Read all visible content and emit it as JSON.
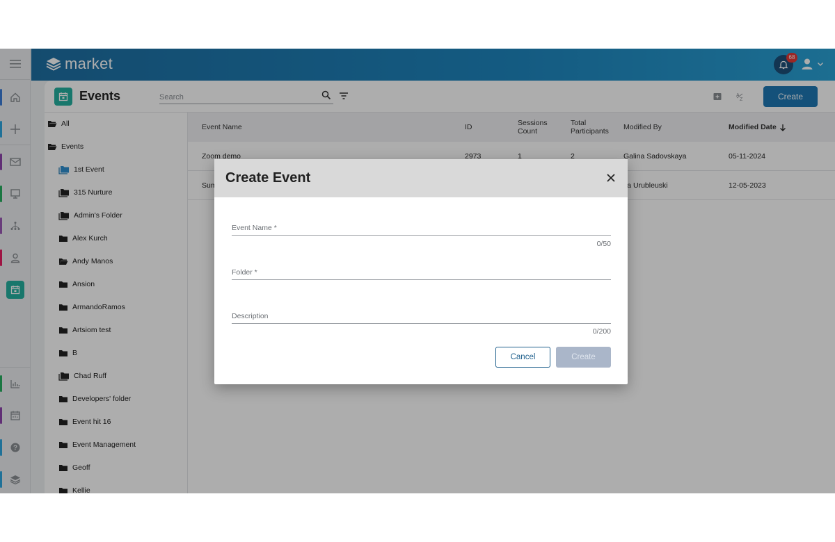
{
  "app": {
    "brand": "market"
  },
  "notifications": {
    "count": "68"
  },
  "page": {
    "title": "Events"
  },
  "search": {
    "placeholder": "Search"
  },
  "toolbar": {
    "create_label": "Create"
  },
  "rail": {
    "items": [
      {
        "name": "menu-icon",
        "color": ""
      },
      {
        "name": "home-icon",
        "color": "#3b7dd8"
      },
      {
        "name": "plus-icon",
        "color": "#2ea7e0"
      },
      {
        "name": "mail-icon",
        "color": "#8e44ad"
      },
      {
        "name": "monitor-icon",
        "color": "#27ae60"
      },
      {
        "name": "hierarchy-icon",
        "color": "#9b59b6"
      },
      {
        "name": "contact-icon",
        "color": "#e91e63"
      },
      {
        "name": "calendar-icon",
        "color": "#24b0a0"
      },
      {
        "name": "analytics-icon",
        "color": "#27ae60"
      },
      {
        "name": "schedule-icon",
        "color": "#8e44ad"
      },
      {
        "name": "help-icon",
        "color": "#2ea7e0"
      },
      {
        "name": "layers-icon",
        "color": "#2ea7e0"
      }
    ]
  },
  "tree": {
    "items": [
      {
        "label": "All",
        "level": 0,
        "icon": "open-folder-icon"
      },
      {
        "label": "Events",
        "level": 0,
        "icon": "open-folder-icon"
      },
      {
        "label": "1st Event",
        "level": 1,
        "icon": "folder-stack-blue-icon"
      },
      {
        "label": "315 Nurture",
        "level": 1,
        "icon": "folder-stack-icon"
      },
      {
        "label": "Admin's Folder",
        "level": 1,
        "icon": "folder-stack-icon"
      },
      {
        "label": "Alex Kurch",
        "level": 1,
        "icon": "folder-icon"
      },
      {
        "label": "Andy Manos",
        "level": 1,
        "icon": "open-folder-icon"
      },
      {
        "label": "Ansion",
        "level": 1,
        "icon": "folder-icon"
      },
      {
        "label": "ArmandoRamos",
        "level": 1,
        "icon": "folder-icon"
      },
      {
        "label": "Artsiom test",
        "level": 1,
        "icon": "folder-icon"
      },
      {
        "label": "B",
        "level": 1,
        "icon": "folder-icon"
      },
      {
        "label": "Chad Ruff",
        "level": 1,
        "icon": "folder-stack-icon"
      },
      {
        "label": "Developers' folder",
        "level": 1,
        "icon": "folder-icon"
      },
      {
        "label": "Event hit 16",
        "level": 1,
        "icon": "folder-icon"
      },
      {
        "label": "Event Management",
        "level": 1,
        "icon": "folder-icon"
      },
      {
        "label": "Geoff",
        "level": 1,
        "icon": "folder-icon"
      },
      {
        "label": "Kellie",
        "level": 1,
        "icon": "folder-icon"
      }
    ]
  },
  "table": {
    "columns": [
      {
        "label": "Event Name",
        "bold": false
      },
      {
        "label": "ID",
        "bold": false
      },
      {
        "label": "Sessions Count",
        "bold": false
      },
      {
        "label": "Total Participants",
        "bold": false
      },
      {
        "label": "Modified By",
        "bold": false
      },
      {
        "label": "Modified Date",
        "bold": true,
        "sort": "desc"
      }
    ],
    "rows": [
      {
        "name": "Zoom demo",
        "id": "2973",
        "sessions": "1",
        "participants": "2",
        "modified_by": "Galina Sadovskaya",
        "modified_date": "05-11-2024"
      },
      {
        "name": "Sum",
        "id": "",
        "sessions": "",
        "participants": "",
        "modified_by": "ya Urubleuski",
        "modified_date": "12-05-2023"
      }
    ]
  },
  "modal": {
    "title": "Create Event",
    "fields": {
      "event_name": {
        "label": "Event Name *",
        "value": "",
        "counter": "0/50"
      },
      "folder": {
        "label": "Folder *",
        "value": ""
      },
      "description": {
        "label": "Description",
        "value": "",
        "counter": "0/200"
      }
    },
    "cancel_label": "Cancel",
    "create_label": "Create"
  }
}
